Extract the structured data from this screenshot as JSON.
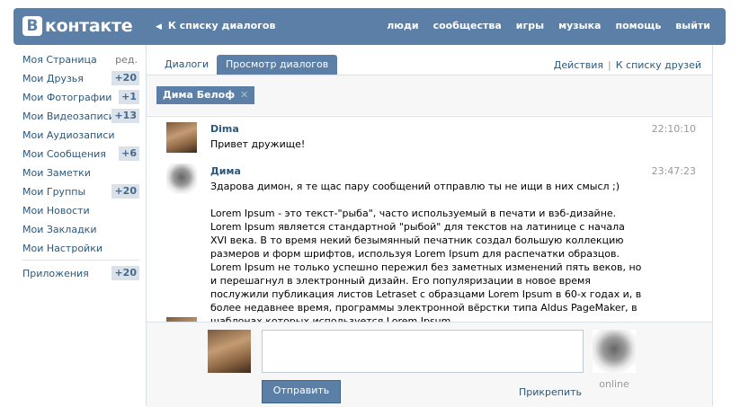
{
  "header": {
    "logo_letter": "B",
    "logo_text": "контакте",
    "back_link": "К списку диалогов",
    "nav": [
      "люди",
      "сообщества",
      "игры",
      "музыка",
      "помощь",
      "выйти"
    ],
    "bg_color": "#5b7fa6"
  },
  "sidebar": {
    "items": [
      {
        "label": "Моя Страница",
        "edit": "ред."
      },
      {
        "label": "Мои Друзья",
        "badge": "+20"
      },
      {
        "label": "Мои Фотографии",
        "badge": "+1"
      },
      {
        "label": "Мои Видеозаписи",
        "badge": "+13"
      },
      {
        "label": "Мои Аудиозаписи"
      },
      {
        "label": "Мои Сообщения",
        "badge": "+6"
      },
      {
        "label": "Мои Заметки"
      },
      {
        "label": "Мои Группы",
        "badge": "+20"
      },
      {
        "label": "Мои Новости"
      },
      {
        "label": "Мои Закладки"
      },
      {
        "label": "Мои Настройки"
      }
    ],
    "apps": {
      "label": "Приложения",
      "badge": "+20"
    }
  },
  "tabs": {
    "items": [
      "Диалоги",
      "Просмотр диалогов"
    ],
    "actions": "Действия",
    "friends_link": "К списку друзей"
  },
  "chip": {
    "label": "Дима Белоф",
    "close": "✕"
  },
  "messages": [
    {
      "name": "Dima",
      "time": "22:10:10",
      "text": "Привет дружище!",
      "avatar": "photo-avatar"
    },
    {
      "name": "Дима",
      "time": "23:47:23",
      "text": "Здарова димон, я те щас пару сообщений отправлю ты не ищи в них смысл ;)",
      "avatar": "cat-avatar",
      "text2": "Lorem Ipsum - это текст-\"рыба\", часто используемый в печати и вэб-дизайне. Lorem Ipsum является стандартной \"рыбой\" для текстов на латинице с начала XVI века. В то время некий безымянный печатник создал большую коллекцию размеров и форм шрифтов, используя Lorem Ipsum для распечатки образцов. Lorem Ipsum не только успешно пережил без заметных изменений пять веков, но и перешагнул в электронный дизайн. Его популяризации в новое время послужили публикация листов Letraset с образцами Lorem Ipsum в 60-х годах и, в более недавнее время, программы электронной вёрстки типа Aldus PageMaker, в шаблонах которых используется Lorem Ipsum."
    }
  ],
  "composer": {
    "message_value": "",
    "send_label": "Отправить",
    "attach_label": "Прикрепить",
    "status": "online"
  }
}
